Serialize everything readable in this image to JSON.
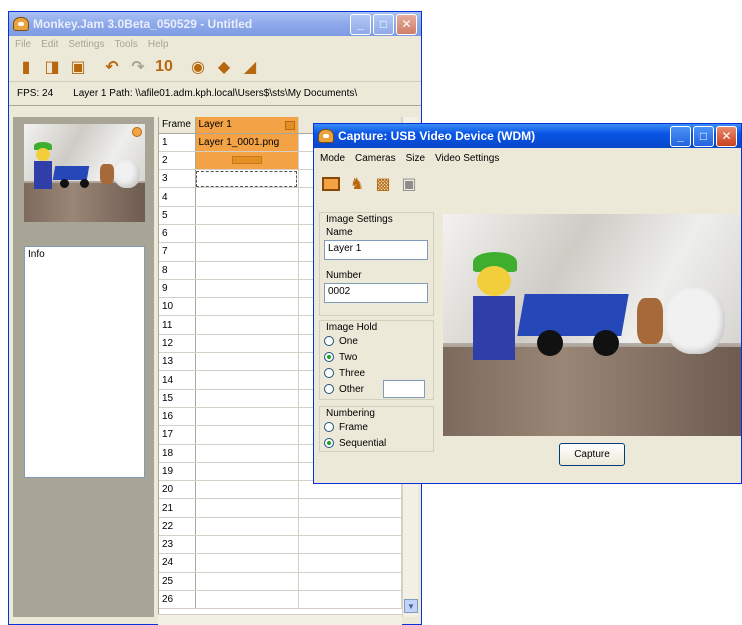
{
  "main_window": {
    "title": "Monkey.Jam 3.0Beta_050529 - Untitled",
    "menu": [
      "File",
      "Edit",
      "Settings",
      "Tools",
      "Help"
    ],
    "fps_label": "FPS: 24",
    "layer_path_label": "Layer 1 Path: \\\\afile01.adm.kph.local\\Users$\\sts\\My Documents\\",
    "info_label": "Info",
    "grid": {
      "frame_header": "Frame",
      "layer_header": "Layer 1",
      "frame_numbers": [
        "1",
        "2",
        "3",
        "4",
        "5",
        "6",
        "7",
        "8",
        "9",
        "10",
        "11",
        "12",
        "13",
        "14",
        "15",
        "16",
        "17",
        "18",
        "19",
        "20",
        "21",
        "22",
        "23",
        "24",
        "25",
        "26"
      ],
      "cell_1": "Layer 1_0001.png"
    }
  },
  "capture_window": {
    "title": "Capture: USB Video Device (WDM)",
    "menu": [
      "Mode",
      "Cameras",
      "Size",
      "Video Settings"
    ],
    "image_settings": {
      "group_title": "Image Settings",
      "name_label": "Name",
      "name_value": "Layer 1",
      "number_label": "Number",
      "number_value": "0002"
    },
    "image_hold": {
      "group_title": "Image Hold",
      "options": [
        "One",
        "Two",
        "Three",
        "Other"
      ],
      "selected": "Two"
    },
    "numbering": {
      "group_title": "Numbering",
      "options": [
        "Frame",
        "Sequential"
      ],
      "selected": "Sequential"
    },
    "capture_button": "Capture"
  },
  "colors": {
    "title_active": "#0a55e6",
    "layer_orange": "#f3a345",
    "window_bg": "#ece9d8"
  }
}
